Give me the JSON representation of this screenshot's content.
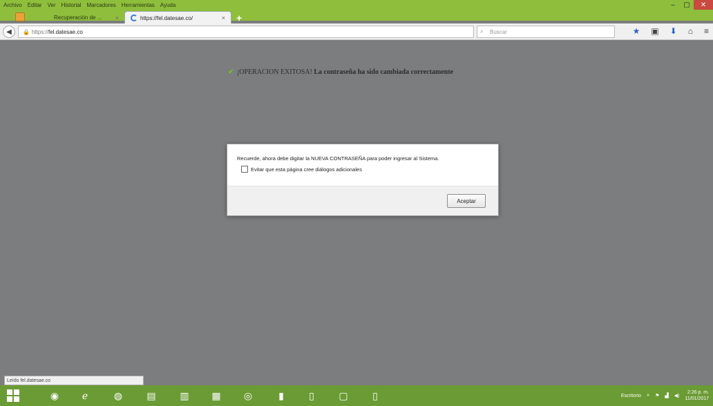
{
  "menu": [
    "Archivo",
    "Editar",
    "Ver",
    "Historial",
    "Marcadores",
    "Herramientas",
    "Ayuda"
  ],
  "tabs": [
    {
      "title": "Recuperación de ...",
      "active": false
    },
    {
      "title": "https://fel.datesae.co/",
      "active": true
    }
  ],
  "address_bar": {
    "scheme": "https://",
    "host": "fel.datesae.co"
  },
  "search": {
    "placeholder": "Buscar"
  },
  "page": {
    "success_prefix": "¡OPERACION EXITOSA!",
    "success_text": "La contraseña ha sido cambiada correctamente"
  },
  "dialog": {
    "message": "Recuerde, ahora debe digitar la NUEVA CONTRASEÑA para poder ingresar al Sistema.",
    "checkbox_label": "Evitar que esta página cree diálogos adicionales",
    "accept_label": "Aceptar"
  },
  "status_bar": {
    "text": "Leído fel.datesae.co"
  },
  "tray": {
    "desktop_label": "Escritorio",
    "time": "2:26 p. m.",
    "date": "11/01/2017"
  },
  "colors": {
    "window_accent": "#8fbe3c",
    "taskbar": "#6b9b34",
    "page_bg": "#7c7d7f",
    "success_check": "#6fbf2e"
  }
}
